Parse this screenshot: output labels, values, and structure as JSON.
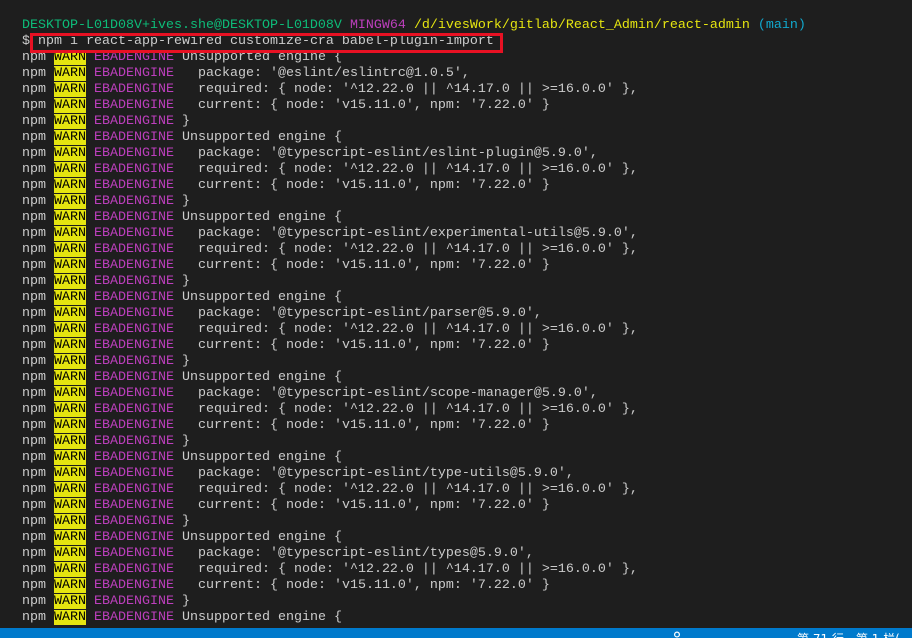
{
  "colors": {
    "background": "#1e1e1e",
    "foreground": "#cccccc",
    "prompt_user_host": "#0dbc79",
    "prompt_system": "#bc3fbc",
    "prompt_path": "#e5e510",
    "prompt_branch": "#11a8cd",
    "warn_background": "#e5e510",
    "warn_foreground": "#000000",
    "error_code": "#bc3fbc",
    "highlight_box": "#e81123",
    "status_bar": "#007acc",
    "status_bar_text": "#ffffff"
  },
  "terminal": {
    "prompt": {
      "user_host": "DESKTOP-L01D08V+ives.she@DESKTOP-L01D08V",
      "system": "MINGW64",
      "path": "/d/ivesWork/gitlab/React_Admin/react-admin",
      "branch": "(main)"
    },
    "command": {
      "symbol": "$",
      "text": "npm i react-app-rewired customize-cra babel-plugin-import"
    },
    "output_lines": [
      {
        "prefix": "npm",
        "level": "WARN",
        "code": "EBADENGINE",
        "text": "Unsupported engine {"
      },
      {
        "prefix": "npm",
        "level": "WARN",
        "code": "EBADENGINE",
        "text": "  package: '@eslint/eslintrc@1.0.5',"
      },
      {
        "prefix": "npm",
        "level": "WARN",
        "code": "EBADENGINE",
        "text": "  required: { node: '^12.22.0 || ^14.17.0 || >=16.0.0' },"
      },
      {
        "prefix": "npm",
        "level": "WARN",
        "code": "EBADENGINE",
        "text": "  current: { node: 'v15.11.0', npm: '7.22.0' }"
      },
      {
        "prefix": "npm",
        "level": "WARN",
        "code": "EBADENGINE",
        "text": "}"
      },
      {
        "prefix": "npm",
        "level": "WARN",
        "code": "EBADENGINE",
        "text": "Unsupported engine {"
      },
      {
        "prefix": "npm",
        "level": "WARN",
        "code": "EBADENGINE",
        "text": "  package: '@typescript-eslint/eslint-plugin@5.9.0',"
      },
      {
        "prefix": "npm",
        "level": "WARN",
        "code": "EBADENGINE",
        "text": "  required: { node: '^12.22.0 || ^14.17.0 || >=16.0.0' },"
      },
      {
        "prefix": "npm",
        "level": "WARN",
        "code": "EBADENGINE",
        "text": "  current: { node: 'v15.11.0', npm: '7.22.0' }"
      },
      {
        "prefix": "npm",
        "level": "WARN",
        "code": "EBADENGINE",
        "text": "}"
      },
      {
        "prefix": "npm",
        "level": "WARN",
        "code": "EBADENGINE",
        "text": "Unsupported engine {"
      },
      {
        "prefix": "npm",
        "level": "WARN",
        "code": "EBADENGINE",
        "text": "  package: '@typescript-eslint/experimental-utils@5.9.0',"
      },
      {
        "prefix": "npm",
        "level": "WARN",
        "code": "EBADENGINE",
        "text": "  required: { node: '^12.22.0 || ^14.17.0 || >=16.0.0' },"
      },
      {
        "prefix": "npm",
        "level": "WARN",
        "code": "EBADENGINE",
        "text": "  current: { node: 'v15.11.0', npm: '7.22.0' }"
      },
      {
        "prefix": "npm",
        "level": "WARN",
        "code": "EBADENGINE",
        "text": "}"
      },
      {
        "prefix": "npm",
        "level": "WARN",
        "code": "EBADENGINE",
        "text": "Unsupported engine {"
      },
      {
        "prefix": "npm",
        "level": "WARN",
        "code": "EBADENGINE",
        "text": "  package: '@typescript-eslint/parser@5.9.0',"
      },
      {
        "prefix": "npm",
        "level": "WARN",
        "code": "EBADENGINE",
        "text": "  required: { node: '^12.22.0 || ^14.17.0 || >=16.0.0' },"
      },
      {
        "prefix": "npm",
        "level": "WARN",
        "code": "EBADENGINE",
        "text": "  current: { node: 'v15.11.0', npm: '7.22.0' }"
      },
      {
        "prefix": "npm",
        "level": "WARN",
        "code": "EBADENGINE",
        "text": "}"
      },
      {
        "prefix": "npm",
        "level": "WARN",
        "code": "EBADENGINE",
        "text": "Unsupported engine {"
      },
      {
        "prefix": "npm",
        "level": "WARN",
        "code": "EBADENGINE",
        "text": "  package: '@typescript-eslint/scope-manager@5.9.0',"
      },
      {
        "prefix": "npm",
        "level": "WARN",
        "code": "EBADENGINE",
        "text": "  required: { node: '^12.22.0 || ^14.17.0 || >=16.0.0' },"
      },
      {
        "prefix": "npm",
        "level": "WARN",
        "code": "EBADENGINE",
        "text": "  current: { node: 'v15.11.0', npm: '7.22.0' }"
      },
      {
        "prefix": "npm",
        "level": "WARN",
        "code": "EBADENGINE",
        "text": "}"
      },
      {
        "prefix": "npm",
        "level": "WARN",
        "code": "EBADENGINE",
        "text": "Unsupported engine {"
      },
      {
        "prefix": "npm",
        "level": "WARN",
        "code": "EBADENGINE",
        "text": "  package: '@typescript-eslint/type-utils@5.9.0',"
      },
      {
        "prefix": "npm",
        "level": "WARN",
        "code": "EBADENGINE",
        "text": "  required: { node: '^12.22.0 || ^14.17.0 || >=16.0.0' },"
      },
      {
        "prefix": "npm",
        "level": "WARN",
        "code": "EBADENGINE",
        "text": "  current: { node: 'v15.11.0', npm: '7.22.0' }"
      },
      {
        "prefix": "npm",
        "level": "WARN",
        "code": "EBADENGINE",
        "text": "}"
      },
      {
        "prefix": "npm",
        "level": "WARN",
        "code": "EBADENGINE",
        "text": "Unsupported engine {"
      },
      {
        "prefix": "npm",
        "level": "WARN",
        "code": "EBADENGINE",
        "text": "  package: '@typescript-eslint/types@5.9.0',"
      },
      {
        "prefix": "npm",
        "level": "WARN",
        "code": "EBADENGINE",
        "text": "  required: { node: '^12.22.0 || ^14.17.0 || >=16.0.0' },"
      },
      {
        "prefix": "npm",
        "level": "WARN",
        "code": "EBADENGINE",
        "text": "  current: { node: 'v15.11.0', npm: '7.22.0' }"
      },
      {
        "prefix": "npm",
        "level": "WARN",
        "code": "EBADENGINE",
        "text": "}"
      },
      {
        "prefix": "npm",
        "level": "WARN",
        "code": "EBADENGINE",
        "text": "Unsupported engine {"
      }
    ]
  },
  "status_bar": {
    "item_icon": "person-icon",
    "cursor_position": "第 71 行，第 1 栏("
  }
}
